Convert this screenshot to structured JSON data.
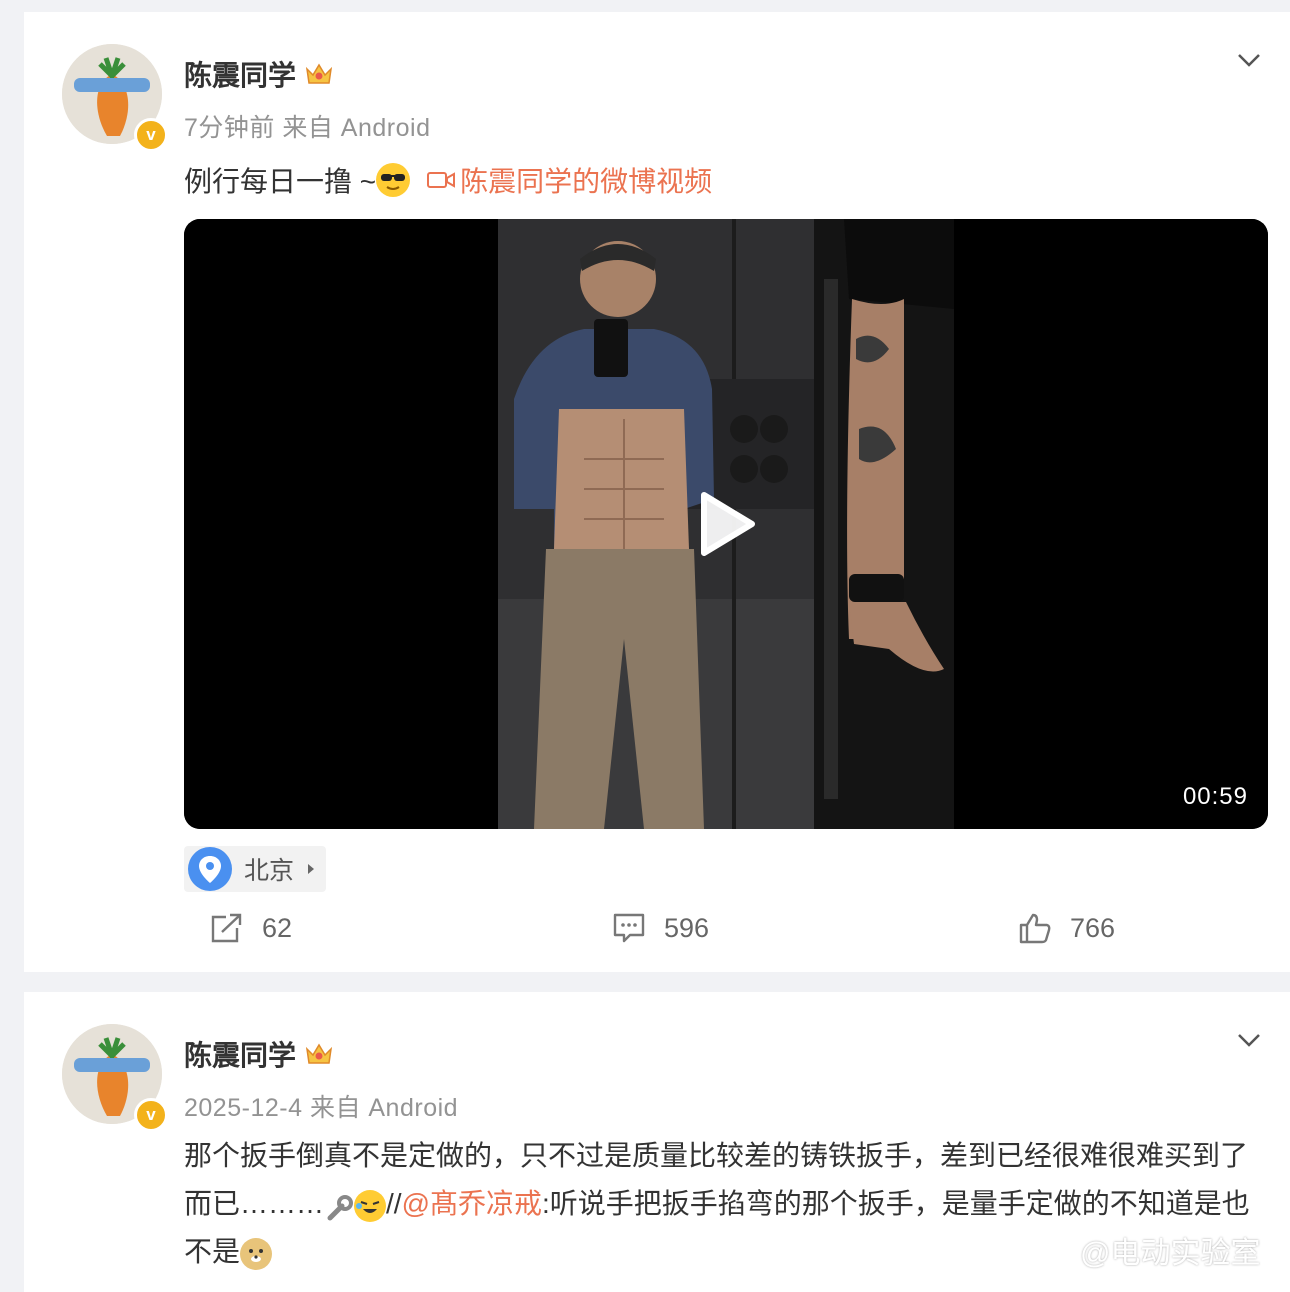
{
  "post1": {
    "author": "陈震同学",
    "time": "7分钟前",
    "source": "来自 Android",
    "text": "例行每日一撸 ~",
    "video_link": "陈震同学的微博视频",
    "video_duration": "00:59",
    "location": "北京",
    "repost_count": "62",
    "comment_count": "596",
    "like_count": "766"
  },
  "post2": {
    "author": "陈震同学",
    "time": "2025-12-4",
    "source": "来自 Android",
    "text_part1": "那个扳手倒真不是定做的，只不过是质量比较差的铸铁扳手，差到已经很难很难买到了而已………",
    "text_sep": "//",
    "mention": "@髙乔凉戒",
    "text_part2": ":听说手把扳手掐弯的那个扳手，是量手定做的不知道是也不是"
  },
  "watermark": "@电动实验室",
  "colors": {
    "accent": "#eb7350",
    "verified": "#f3b21b",
    "location_icon": "#4a90f0"
  }
}
